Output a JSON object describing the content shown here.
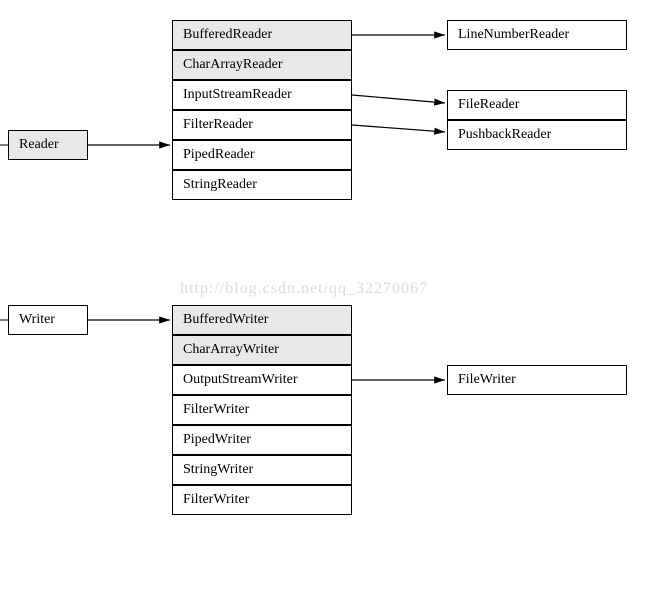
{
  "reader": {
    "root": "Reader",
    "children": [
      "BufferedReader",
      "CharArrayReader",
      "InputStreamReader",
      "FilterReader",
      "PipedReader",
      "StringReader"
    ],
    "grandchildren": {
      "linenumber": "LineNumberReader",
      "filereader": "FileReader",
      "pushback": "PushbackReader"
    }
  },
  "writer": {
    "root": "Writer",
    "children": [
      "BufferedWriter",
      "CharArrayWriter",
      "OutputStreamWriter",
      "FilterWriter",
      "PipedWriter",
      "StringWriter",
      "FilterWriter"
    ],
    "grandchildren": {
      "filewriter": "FileWriter"
    }
  },
  "watermark": "http://blog.csdn.net/qq_32270067",
  "chart_data": {
    "type": "table",
    "title": "Java Reader/Writer class hierarchy",
    "hierarchy": [
      {
        "name": "Reader",
        "children": [
          {
            "name": "BufferedReader",
            "children": [
              {
                "name": "LineNumberReader"
              }
            ]
          },
          {
            "name": "CharArrayReader"
          },
          {
            "name": "InputStreamReader",
            "children": [
              {
                "name": "FileReader"
              }
            ]
          },
          {
            "name": "FilterReader",
            "children": [
              {
                "name": "PushbackReader"
              }
            ]
          },
          {
            "name": "PipedReader"
          },
          {
            "name": "StringReader"
          }
        ]
      },
      {
        "name": "Writer",
        "children": [
          {
            "name": "BufferedWriter"
          },
          {
            "name": "CharArrayWriter"
          },
          {
            "name": "OutputStreamWriter",
            "children": [
              {
                "name": "FileWriter"
              }
            ]
          },
          {
            "name": "FilterWriter"
          },
          {
            "name": "PipedWriter"
          },
          {
            "name": "StringWriter"
          },
          {
            "name": "FilterWriter"
          }
        ]
      }
    ]
  }
}
